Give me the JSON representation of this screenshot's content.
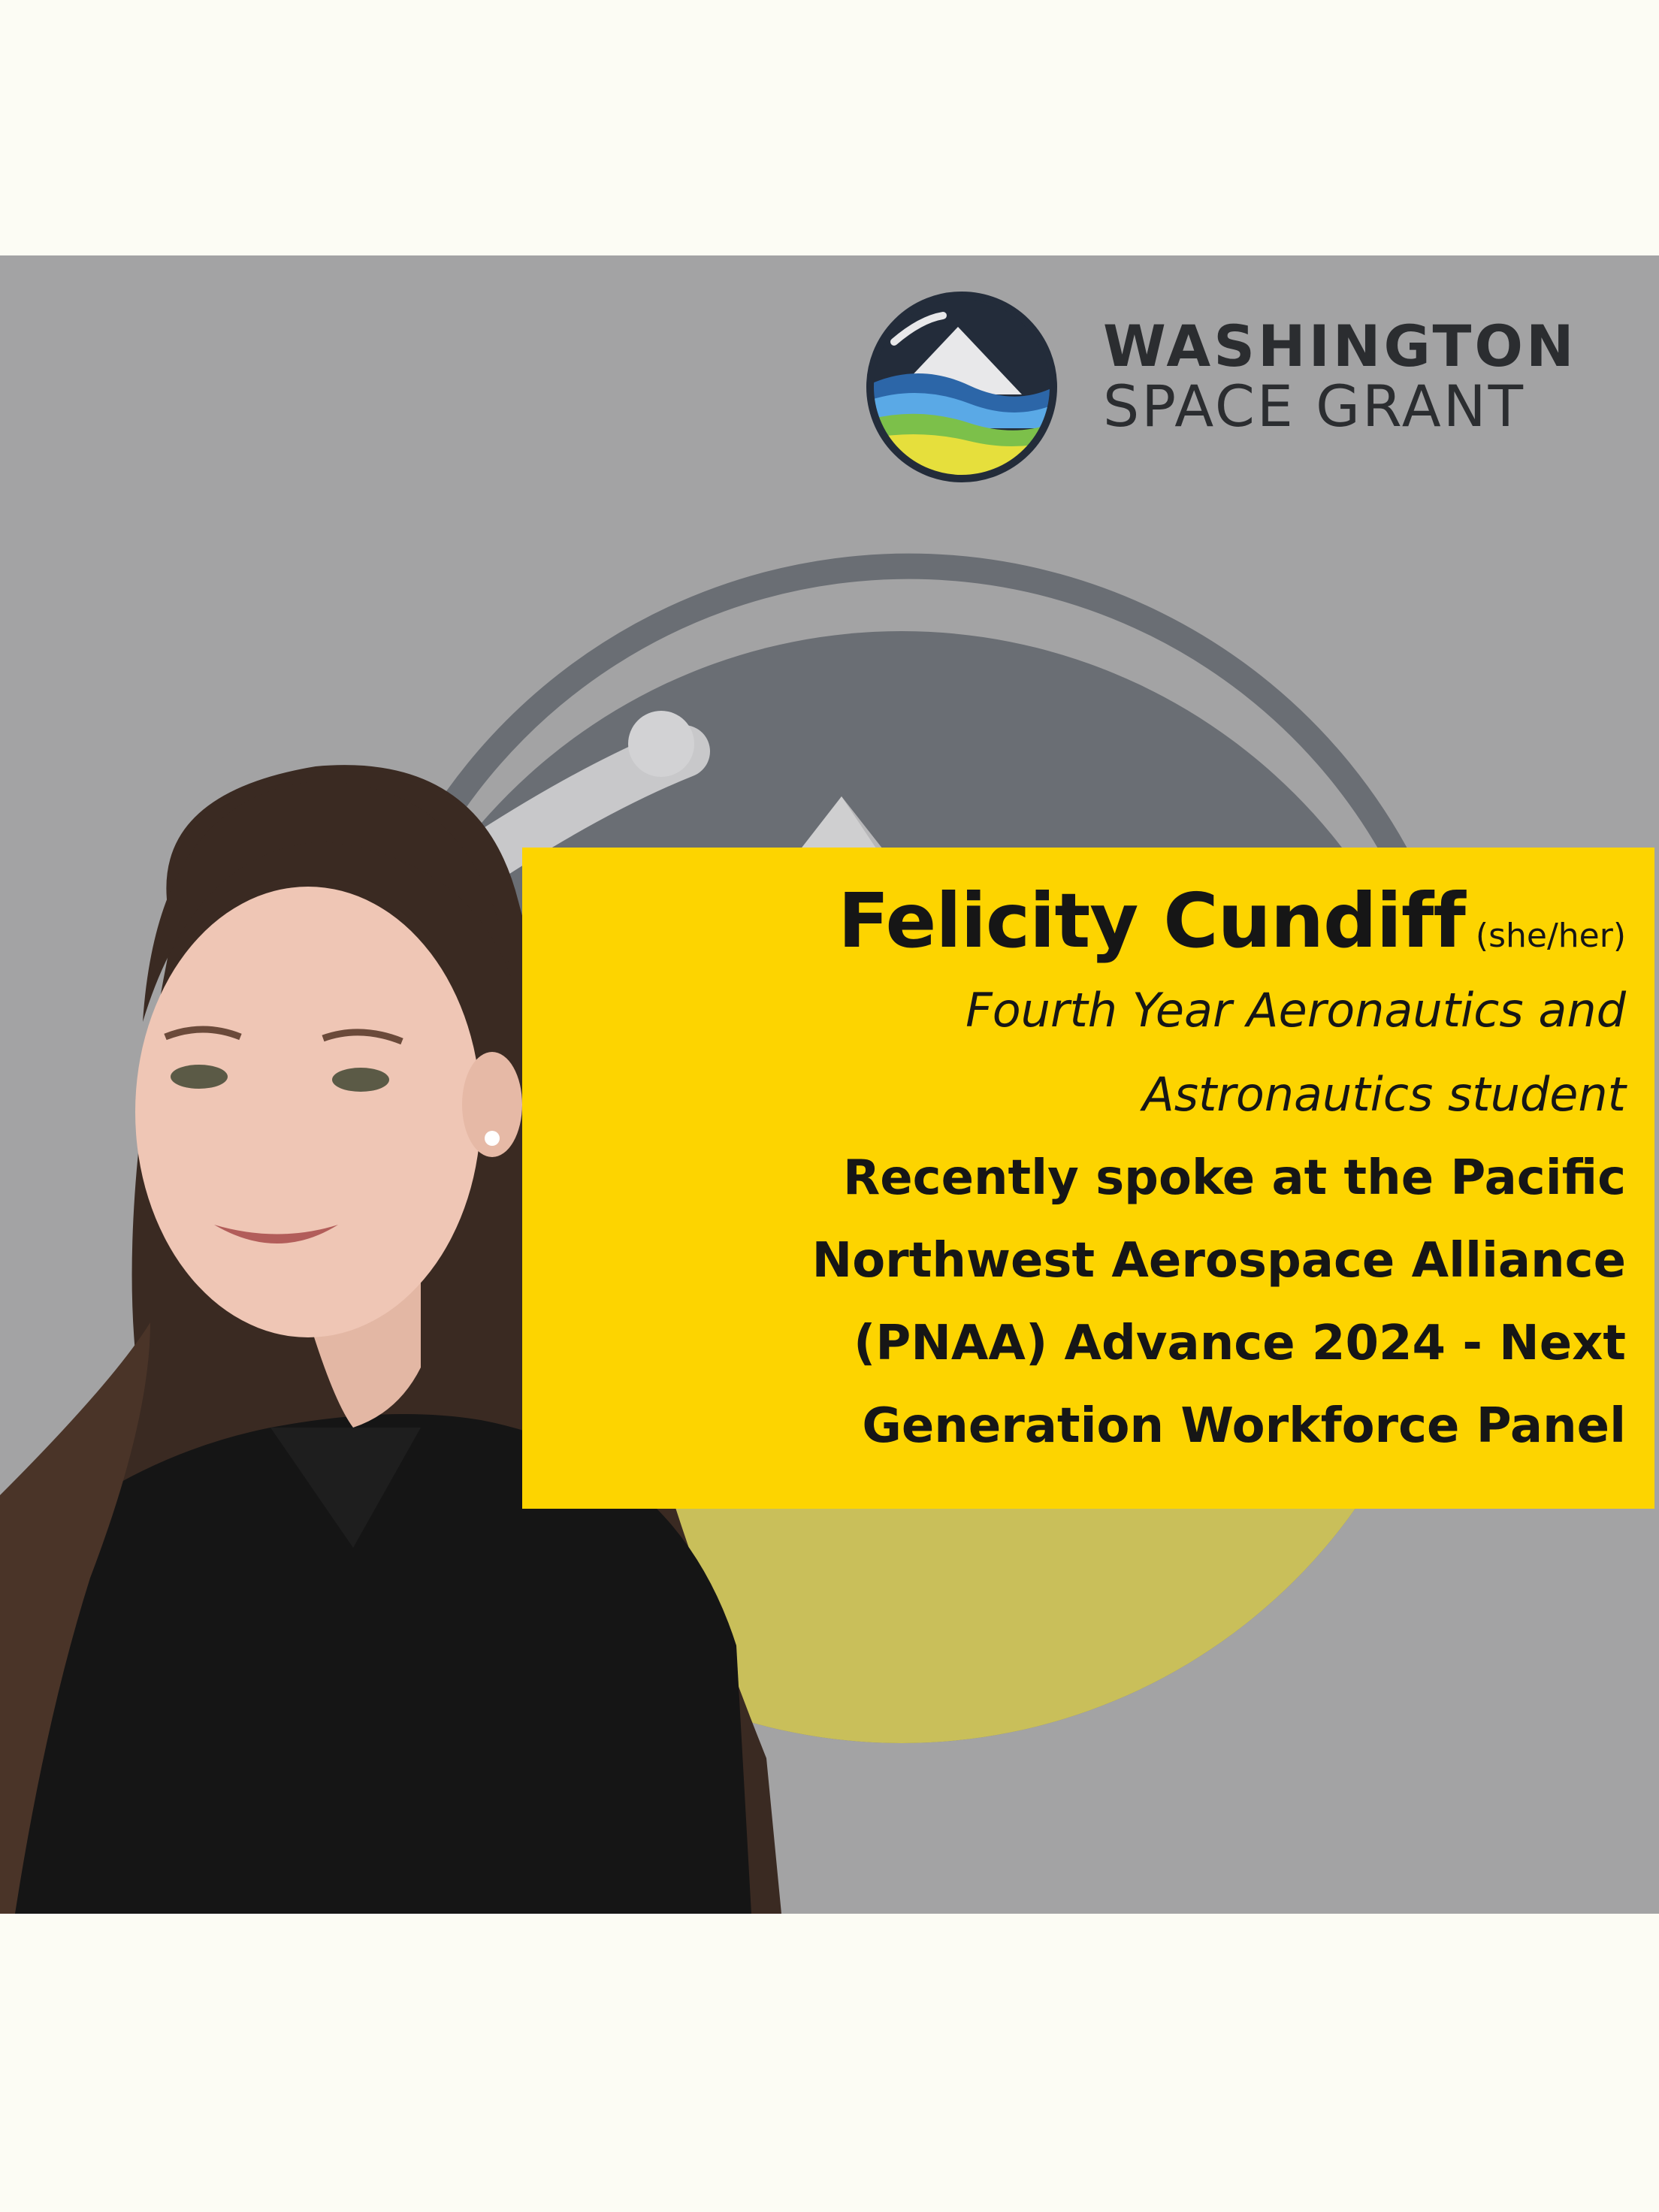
{
  "brand": {
    "line1": "WASHINGTON",
    "line2": "SPACE GRANT",
    "colors": {
      "dark_navy": "#1f2a3a",
      "sky_blue": "#5aa9e6",
      "green": "#7cc04a",
      "yellow": "#fdd400"
    }
  },
  "profile": {
    "name": "Felicity Cundiff",
    "pronouns": "(she/her)",
    "role_lines": [
      "Fourth Year Aeronautics and",
      "Astronautics student"
    ],
    "achievement_lines": [
      "Recently spoke at the Pacific",
      "Northwest Aerospace Alliance",
      "(PNAA) Advance 2024 - Next",
      "Generation Workforce Panel"
    ]
  },
  "theme": {
    "page_background": "#fcfcf4",
    "panel_background": "#a3a3a4",
    "highlight": "#fdd400",
    "text": "#161616"
  }
}
